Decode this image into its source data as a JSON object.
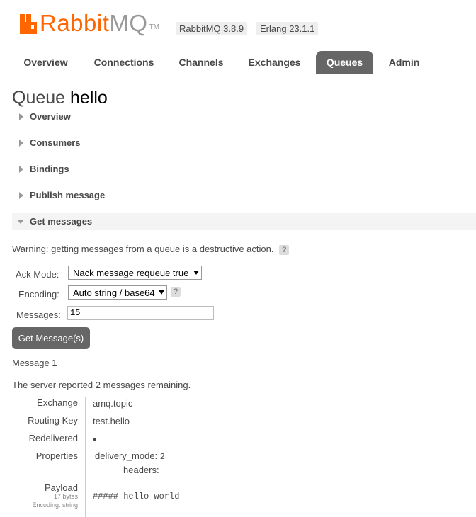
{
  "header": {
    "brand_part1": "Rabbit",
    "brand_part2": "MQ",
    "tm": "TM",
    "version": "RabbitMQ 3.8.9",
    "erlang": "Erlang 23.1.1"
  },
  "nav": {
    "tabs": [
      {
        "label": "Overview"
      },
      {
        "label": "Connections"
      },
      {
        "label": "Channels"
      },
      {
        "label": "Exchanges"
      },
      {
        "label": "Queues",
        "active": true
      },
      {
        "label": "Admin"
      }
    ]
  },
  "page": {
    "title_prefix": "Queue",
    "queue_name": "hello"
  },
  "sections": [
    {
      "label": "Overview",
      "open": false
    },
    {
      "label": "Consumers",
      "open": false
    },
    {
      "label": "Bindings",
      "open": false
    },
    {
      "label": "Publish message",
      "open": false
    },
    {
      "label": "Get messages",
      "open": true
    }
  ],
  "get_messages": {
    "warning": "Warning: getting messages from a queue is a destructive action.",
    "help": "?",
    "ack_mode_label": "Ack Mode:",
    "ack_mode_value": "Nack message requeue true",
    "encoding_label": "Encoding:",
    "encoding_value": "Auto string / base64",
    "messages_label": "Messages:",
    "messages_value": "15",
    "button": "Get Message(s)"
  },
  "result": {
    "message_heading": "Message 1",
    "remaining_prefix": "The server reported ",
    "remaining_count": "2",
    "remaining_suffix": " messages remaining.",
    "exchange_label": "Exchange",
    "exchange_value": "amq.topic",
    "routing_key_label": "Routing Key",
    "routing_key_value": "test.hello",
    "redelivered_label": "Redelivered",
    "redelivered_value": "●",
    "properties_label": "Properties",
    "delivery_mode_key": "delivery_mode:",
    "delivery_mode_value": "2",
    "headers_key": "headers:",
    "payload_label": "Payload",
    "payload_size": "17 bytes",
    "payload_encoding": "Encoding: string",
    "payload_value": "##### hello world"
  },
  "colors": {
    "brand_orange": "#ff6600",
    "active_tab": "#666666"
  }
}
